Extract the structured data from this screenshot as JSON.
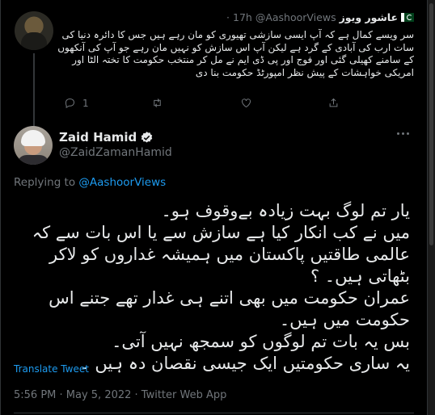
{
  "reply_tweet": {
    "display_name": "عاشور ویوز",
    "handle": "@AashoorViews",
    "time": "· 17h",
    "text": "سر ویسے کمال ہے کہ آپ ایسی سازشی تھیوری کو مان رہے ہیں جس کا دائرہ دنیا کی سات ارب کی آبادی کے گرد ہے لیکن آپ اس سازش کو نہیں مان رہے جو آپ کی آنکھوں کے سامنے کھیلی گئی اور فوج اور پی ڈی ایم نے مل کر منتخب حکومت کا تختہ الٹا اور امریکی خواہشات کے پیش نظر امپورٹڈ حکومت بنا دی",
    "reply_count": "1",
    "retweet_count": "",
    "like_count": "",
    "icons": [
      "reply-icon",
      "retweet-icon",
      "like-icon",
      "share-icon"
    ]
  },
  "main_tweet": {
    "display_name": "Zaid Hamid",
    "handle": "@ZaidZamanHamid",
    "replying_prefix": "Replying to ",
    "replying_to": "@AashoorViews",
    "lines": [
      "یار تم لوگ بہت زیادہ بےوقوف ہو۔",
      "میں نے کب انکار کیا ہے سازش سے یا اس بات سے کہ عالمی طاقتیں پاکستان میں ہمیشہ غداروں کو لاکر بٹھاتی ہیں۔ ؟",
      "عمران حکومت میں بھی اتنے ہی غدار تھے جتنے اس حکومت میں ہیں۔",
      "بس یہ بات تم لوگوں کو سمجھ نہیں آتی۔",
      "یہ ساری حکومتیں ایک جیسی نقصان دہ ہیں ۔"
    ],
    "translate_label": "Translate Tweet",
    "timestamp": "5:56 PM · May 5, 2022 · Twitter Web App"
  },
  "colors": {
    "background": "#000000",
    "link": "#1d9bf0",
    "muted": "#71767b",
    "text": "#e7e9ea"
  }
}
